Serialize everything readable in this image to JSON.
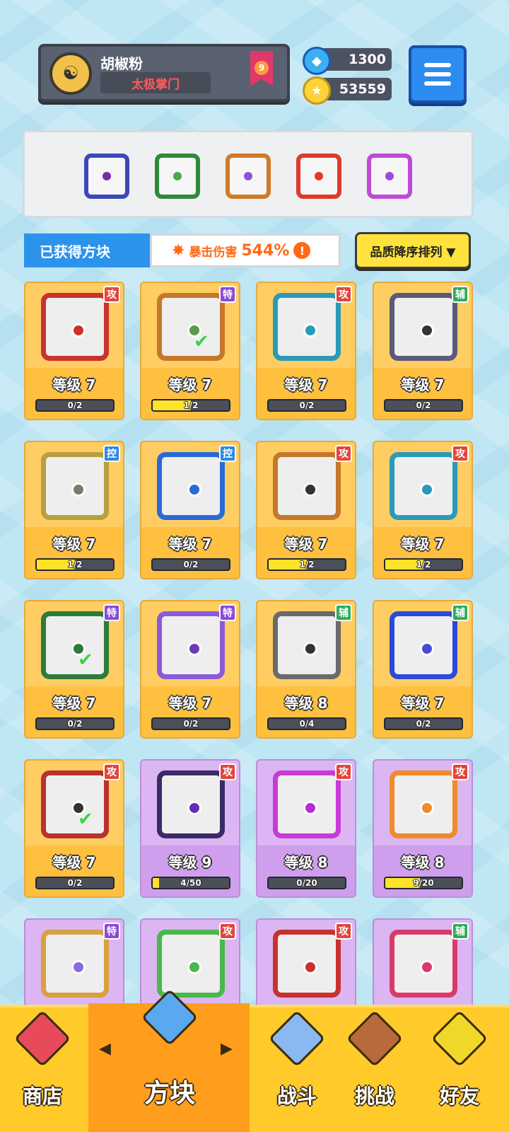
{
  "player": {
    "name": "胡椒粉",
    "sect": "太极掌门",
    "rank": "9"
  },
  "currency": {
    "gems": "1300",
    "coins": "53559"
  },
  "icons": {
    "gem": "gem-icon",
    "coin": "coin-icon",
    "menu": "menu-icon",
    "rank": "rank-badge-icon"
  },
  "equipped": [
    {
      "name": "saw-block-icon",
      "border": "#3b49b8",
      "dot": "#7a2aa8"
    },
    {
      "name": "vine-block-icon",
      "border": "#2e8a3a",
      "dot": "#4aa84a"
    },
    {
      "name": "infinity-block-icon",
      "border": "#d17a26",
      "dot": "#8a55d8"
    },
    {
      "name": "fire-block-icon",
      "border": "#e03a2a",
      "dot": "#e03a2a"
    },
    {
      "name": "swirl-block-icon",
      "border": "#c04ad8",
      "dot": "#9a4ad8"
    }
  ],
  "obtained_label": "已获得方块",
  "crit": {
    "label": "暴击伤害",
    "value": "544%",
    "warn": "!"
  },
  "sort_label": "品质降序排列 ▼",
  "cards": [
    {
      "tag": "攻",
      "level": "等级 7",
      "progress": "0/2",
      "fill": 0,
      "style": "gold",
      "frame": "#c9322e",
      "dot": "#c9322e",
      "check": false
    },
    {
      "tag": "特",
      "level": "等级 7",
      "progress": "1/2",
      "fill": 0.5,
      "style": "gold",
      "frame": "#c6772a",
      "dot": "#5a9a4a",
      "check": true
    },
    {
      "tag": "攻",
      "level": "等级 7",
      "progress": "0/2",
      "fill": 0,
      "style": "gold",
      "frame": "#2a9ab8",
      "dot": "#2a9ab8",
      "check": false
    },
    {
      "tag": "辅",
      "level": "等级 7",
      "progress": "0/2",
      "fill": 0,
      "style": "gold",
      "frame": "#5a5a7a",
      "dot": "#333333",
      "check": false
    },
    {
      "tag": "控",
      "level": "等级 7",
      "progress": "1/2",
      "fill": 0.5,
      "style": "gold",
      "frame": "#b8a040",
      "dot": "#7a7a6a",
      "check": false
    },
    {
      "tag": "控",
      "level": "等级 7",
      "progress": "0/2",
      "fill": 0,
      "style": "gold",
      "frame": "#2a6ad8",
      "dot": "#2a6ad8",
      "check": false
    },
    {
      "tag": "攻",
      "level": "等级 7",
      "progress": "1/2",
      "fill": 0.5,
      "style": "gold",
      "frame": "#c6772a",
      "dot": "#333333",
      "check": false
    },
    {
      "tag": "攻",
      "level": "等级 7",
      "progress": "1/2",
      "fill": 0.5,
      "style": "gold",
      "frame": "#2a9ab8",
      "dot": "#2a9ab8",
      "check": false
    },
    {
      "tag": "特",
      "level": "等级 7",
      "progress": "0/2",
      "fill": 0,
      "style": "gold",
      "frame": "#2e7a3a",
      "dot": "#2e7a3a",
      "check": true
    },
    {
      "tag": "特",
      "level": "等级 7",
      "progress": "0/2",
      "fill": 0,
      "style": "gold",
      "frame": "#8a5ad8",
      "dot": "#6a3ab8",
      "check": false
    },
    {
      "tag": "辅",
      "level": "等级 8",
      "progress": "0/4",
      "fill": 0,
      "style": "gold",
      "frame": "#6a6a6a",
      "dot": "#333333",
      "check": false
    },
    {
      "tag": "辅",
      "level": "等级 7",
      "progress": "0/2",
      "fill": 0,
      "style": "gold",
      "frame": "#2a4ad8",
      "dot": "#4a4ad8",
      "check": false
    },
    {
      "tag": "攻",
      "level": "等级 7",
      "progress": "0/2",
      "fill": 0,
      "style": "gold",
      "frame": "#b8322e",
      "dot": "#333333",
      "check": true
    },
    {
      "tag": "攻",
      "level": "等级 9",
      "progress": "4/50",
      "fill": 0.08,
      "style": "purple",
      "frame": "#3a2a6a",
      "dot": "#6a2ab8",
      "check": false
    },
    {
      "tag": "攻",
      "level": "等级 8",
      "progress": "0/20",
      "fill": 0,
      "style": "purple",
      "frame": "#c83ad8",
      "dot": "#b82ad8",
      "check": false
    },
    {
      "tag": "攻",
      "level": "等级 8",
      "progress": "9/20",
      "fill": 0.45,
      "style": "purple",
      "frame": "#f08a2a",
      "dot": "#f08a2a",
      "check": false
    },
    {
      "tag": "特",
      "level": "",
      "progress": "",
      "fill": 0,
      "style": "purple",
      "frame": "#d8a040",
      "dot": "#8a6ad8",
      "check": false
    },
    {
      "tag": "攻",
      "level": "",
      "progress": "",
      "fill": 0,
      "style": "purple",
      "frame": "#4ab84a",
      "dot": "#4ab84a",
      "check": false
    },
    {
      "tag": "攻",
      "level": "",
      "progress": "",
      "fill": 0,
      "style": "purple",
      "frame": "#c8322e",
      "dot": "#c8322e",
      "check": false
    },
    {
      "tag": "辅",
      "level": "",
      "progress": "",
      "fill": 0,
      "style": "purple",
      "frame": "#d83a6a",
      "dot": "#d83a6a",
      "check": false
    }
  ],
  "tag_colors": {
    "攻": "#e2463c",
    "特": "#8a4ad8",
    "辅": "#2eaa5a",
    "控": "#2a8ae8"
  },
  "nav": [
    {
      "label": "商店",
      "icon": "shop-icon",
      "color": "#e84a5a"
    },
    {
      "label": "方块",
      "icon": "block-icon",
      "color": "#5aa8f0"
    },
    {
      "label": "战斗",
      "icon": "battle-icon",
      "color": "#8ab8f0"
    },
    {
      "label": "挑战",
      "icon": "challenge-icon",
      "color": "#b86a3a"
    },
    {
      "label": "好友",
      "icon": "friends-icon",
      "color": "#f0d82a"
    }
  ],
  "nav_arrows": {
    "left": "◀",
    "right": "▶"
  }
}
